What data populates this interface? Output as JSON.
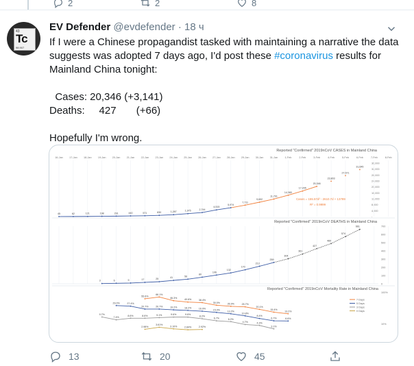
{
  "top_actions": {
    "replies": "2",
    "retweets": "2",
    "likes": "8"
  },
  "tweet": {
    "name": "EV Defender",
    "handle": "@evdefender",
    "separator": "·",
    "time": "18 ч",
    "text_lines": [
      "If I were a Chinese propagandist tasked with maintaining a narrative the data",
      "suggests was adopted 7 days ago, I'd post these ",
      "Mainland China tonight:"
    ],
    "hashtag": "#coronavirus",
    "hashtag_suffix": " results for",
    "cases_line": "  Cases: 20,346 (+3,141)",
    "deaths_line": "Deaths:     427       (+66)",
    "closing": "Hopefully I'm wrong.",
    "avatar": {
      "number": "43",
      "symbol": "Tc",
      "mass": "98.907"
    },
    "actions": {
      "replies": "13",
      "retweets": "20",
      "likes": "45"
    }
  },
  "chart_data": [
    {
      "type": "line",
      "title": "Reported \"Confirmed\" 2019nCoV CASES in Mainland China",
      "x": [
        "16-Jan",
        "17-Jan",
        "18-Jan",
        "19-Jan",
        "20-Jan",
        "21-Jan",
        "22-Jan",
        "23-Jan",
        "24-Jan",
        "25-Jan",
        "26-Jan",
        "27-Jan",
        "28-Jan",
        "29-Jan",
        "30-Jan",
        "31-Jan",
        "1-Feb",
        "2-Feb",
        "3-Feb",
        "4-Feb",
        "5-Feb",
        "6-Feb",
        "7-Feb",
        "8-Feb",
        "9-Feb"
      ],
      "series": [
        {
          "values": [
            45,
            62,
            121,
            198,
            291,
            440,
            571,
            830,
            1287,
            1975,
            2744,
            4515,
            5974,
            7711,
            9692,
            11791,
            14380,
            17205,
            20346
          ]
        }
      ],
      "fit": {
        "label": "Cases = 155.57d² - 2610.7d + 13789",
        "r2": "R² = 0.9999",
        "values": [
          20,
          27,
          35,
          46,
          60,
          75,
          90,
          105,
          115,
          128,
          150,
          168,
          193,
          232,
          247,
          273,
          301,
          319,
          333
        ]
      },
      "projected_labels": [
        "23,803",
        "27,571",
        "31,645"
      ],
      "projected_values": [
        23803,
        27571,
        31645
      ],
      "ylim": [
        0,
        36000
      ],
      "yticks": [
        "36,000",
        "32,000",
        "28,000",
        "24,000",
        "20,000",
        "16,000",
        "12,000",
        "8,000",
        "4,000",
        "-"
      ]
    },
    {
      "type": "line",
      "title": "Reported \"Confirmed\" 2019nCoV DEATHS in Mainland China",
      "series": [
        {
          "values": [
            3,
            6,
            9,
            17,
            25,
            41,
            56,
            80,
            106,
            132,
            170,
            213,
            259,
            304,
            361,
            427,
            489,
            574,
            661
          ]
        }
      ],
      "ylim": [
        0,
        700
      ],
      "yticks": [
        "700",
        "600",
        "500",
        "400",
        "300",
        "200",
        "100",
        "0"
      ]
    },
    {
      "type": "line",
      "title": "Reported \"Confirmed\" 2019nCoV Mortality Rate in Mainland China",
      "legend": [
        "7 Days",
        "5 Days",
        "3 Days",
        "0 Days"
      ],
      "series": [
        {
          "name": "7 Days",
          "values": [
            "55.6%",
            "66.1%",
            "46.3%",
            "40.6%",
            "38.4%",
            "30.0%",
            "26.9%",
            "25.7%",
            "20.1%",
            "15.4%",
            "13.2%"
          ]
        },
        {
          "name": "5 Days",
          "values": [
            "29.0%",
            "27.4%",
            "20.7%",
            "20.7%",
            "19.2%",
            "18.2%",
            "16.9%",
            "15.0%",
            "13.2%",
            "10.8%",
            "8.4%",
            "6.7%",
            "6.6%"
          ]
        },
        {
          "name": "3 Days",
          "values": [
            "9.7%",
            "7.4%",
            "8.6%",
            "8.6%",
            "9.1%",
            "9.6%",
            "9.6%",
            "8.2%",
            "6.7%",
            "6.2%",
            "4.7%",
            "4.3%",
            "3.1%"
          ]
        },
        {
          "name": "0 Days",
          "values": [
            "2.98%",
            "3.61%",
            "3.10%",
            "2.84%",
            "2.92%"
          ]
        }
      ],
      "yticks": [
        "100%",
        "10%"
      ]
    }
  ]
}
